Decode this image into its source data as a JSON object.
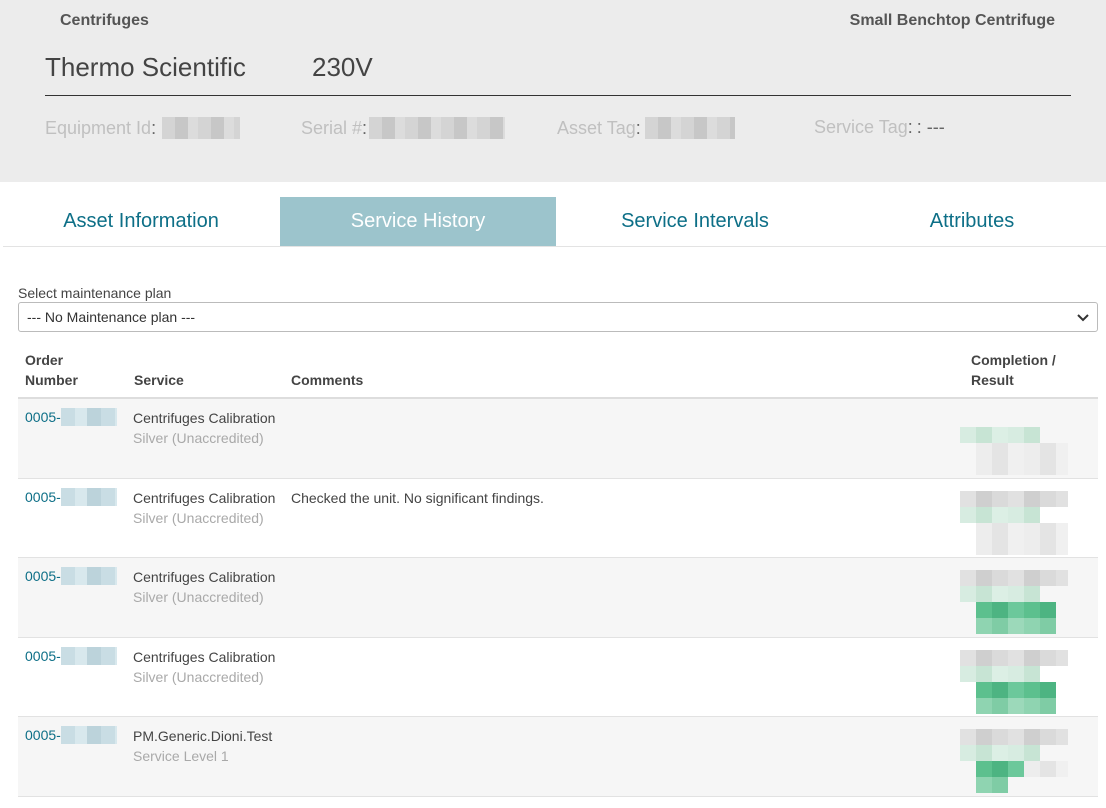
{
  "header": {
    "category": "Centrifuges",
    "equipment_type": "Small Benchtop Centrifuge",
    "manufacturer": "Thermo Scientific",
    "voltage": "230V",
    "equipment_id_label": "Equipment Id",
    "serial_label": "Serial #",
    "asset_tag_label": "Asset Tag",
    "service_tag_label": "Service Tag",
    "service_tag_value": ": ---",
    "separator": ":"
  },
  "tabs": [
    {
      "label": "Asset Information",
      "active": false
    },
    {
      "label": "Service History",
      "active": true
    },
    {
      "label": "Service Intervals",
      "active": false
    },
    {
      "label": "Attributes",
      "active": false
    }
  ],
  "plan": {
    "label": "Select maintenance plan",
    "selected": "--- No Maintenance plan ---"
  },
  "table": {
    "headers": {
      "order_line1": "Order",
      "order_line2": "Number",
      "service": "Service",
      "comments": "Comments",
      "result_line1": "Completion /",
      "result_line2": "Result"
    },
    "rows": [
      {
        "order_prefix": "0005-",
        "service": "Centrifuges Calibration",
        "level": "Silver (Unaccredited)",
        "comment": ""
      },
      {
        "order_prefix": "0005-",
        "service": "Centrifuges Calibration",
        "level": "Silver (Unaccredited)",
        "comment": "Checked the unit. No significant findings."
      },
      {
        "order_prefix": "0005-",
        "service": "Centrifuges Calibration",
        "level": "Silver (Unaccredited)",
        "comment": ""
      },
      {
        "order_prefix": "0005-",
        "service": "Centrifuges Calibration",
        "level": "Silver (Unaccredited)",
        "comment": ""
      },
      {
        "order_prefix": "0005-",
        "service": "PM.Generic.Dioni.Test",
        "level": "Service Level 1",
        "comment": ""
      }
    ]
  },
  "colors": {
    "accent": "#0d6f87",
    "active_tab": "#9cc4cc",
    "header_bg": "#ececec"
  }
}
